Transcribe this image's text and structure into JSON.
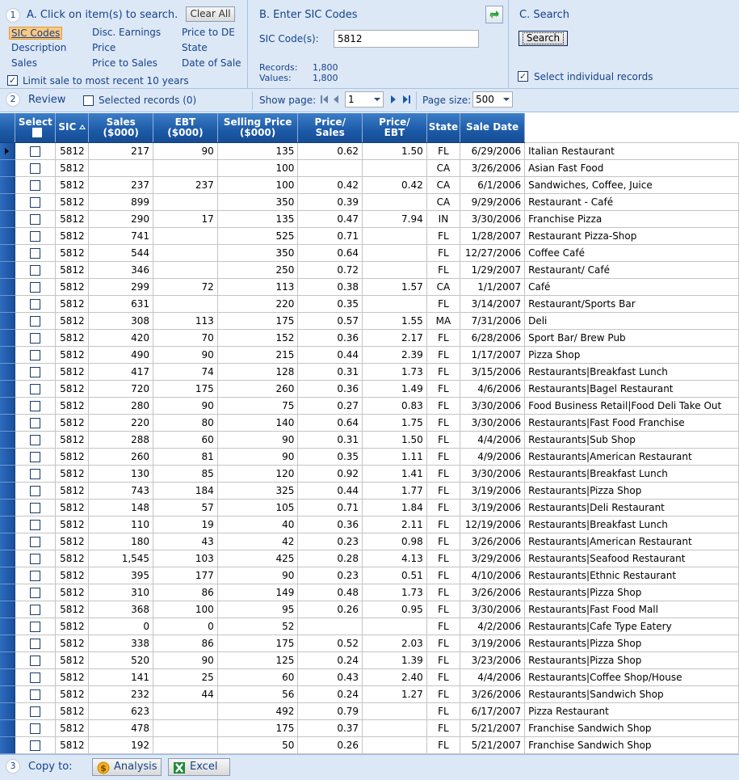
{
  "section_a": {
    "number": "1",
    "title": "A. Click on item(s) to search.",
    "clear_all": "Clear All",
    "items": [
      {
        "label": "SIC Codes",
        "selected": true
      },
      {
        "label": "Disc. Earnings"
      },
      {
        "label": "Price to DE"
      },
      {
        "label": "Description"
      },
      {
        "label": "Price"
      },
      {
        "label": "State"
      },
      {
        "label": "Sales"
      },
      {
        "label": "Price to Sales"
      },
      {
        "label": "Date of Sale"
      }
    ],
    "limit_label": "Limit sale to most recent 10 years",
    "limit_checked": true
  },
  "section_b": {
    "title": "B. Enter SIC Codes",
    "sic_label": "SIC Code(s):",
    "sic_value": "5812",
    "records_label": "Records:",
    "records_value": "1,800",
    "values_label": "Values:",
    "values_value": "1,800"
  },
  "section_c": {
    "title": "C. Search",
    "search_button": "Search",
    "select_individual_label": "Select individual records",
    "select_individual_checked": true
  },
  "toolbar": {
    "number": "2",
    "review_label": "Review",
    "selected_records_label": "Selected records (0)",
    "show_page_label": "Show page:",
    "page_value": "1",
    "page_size_label": "Page size:",
    "page_size_value": "500"
  },
  "grid": {
    "columns": [
      "Select",
      "SIC",
      "Sales ($000)",
      "EBT ($000)",
      "Selling Price ($000)",
      "Price/ Sales",
      "Price/ EBT",
      "State",
      "Sale Date",
      ""
    ],
    "header_lines": {
      "sales": [
        "Sales",
        "($000)"
      ],
      "ebt": [
        "EBT",
        "($000)"
      ],
      "price": [
        "Selling Price",
        "($000)"
      ],
      "ps": [
        "Price/",
        "Sales"
      ],
      "pe": [
        "Price/",
        "EBT"
      ]
    },
    "rows": [
      [
        "5812",
        "217",
        "90",
        "135",
        "0.62",
        "1.50",
        "FL",
        "6/29/2006",
        "Italian Restaurant"
      ],
      [
        "5812",
        "",
        "",
        "100",
        "",
        "",
        "CA",
        "3/26/2006",
        "Asian Fast Food"
      ],
      [
        "5812",
        "237",
        "237",
        "100",
        "0.42",
        "0.42",
        "CA",
        "6/1/2006",
        "Sandwiches, Coffee, Juice"
      ],
      [
        "5812",
        "899",
        "",
        "350",
        "0.39",
        "",
        "CA",
        "9/29/2006",
        "Restaurant - Café"
      ],
      [
        "5812",
        "290",
        "17",
        "135",
        "0.47",
        "7.94",
        "IN",
        "3/30/2006",
        "Franchise Pizza"
      ],
      [
        "5812",
        "741",
        "",
        "525",
        "0.71",
        "",
        "FL",
        "1/28/2007",
        "Restaurant Pizza-Shop"
      ],
      [
        "5812",
        "544",
        "",
        "350",
        "0.64",
        "",
        "FL",
        "12/27/2006",
        "Coffee Café"
      ],
      [
        "5812",
        "346",
        "",
        "250",
        "0.72",
        "",
        "FL",
        "1/29/2007",
        "Restaurant/ Café"
      ],
      [
        "5812",
        "299",
        "72",
        "113",
        "0.38",
        "1.57",
        "CA",
        "1/1/2007",
        "Café"
      ],
      [
        "5812",
        "631",
        "",
        "220",
        "0.35",
        "",
        "FL",
        "3/14/2007",
        "Restaurant/Sports Bar"
      ],
      [
        "5812",
        "308",
        "113",
        "175",
        "0.57",
        "1.55",
        "MA",
        "7/31/2006",
        "Deli"
      ],
      [
        "5812",
        "420",
        "70",
        "152",
        "0.36",
        "2.17",
        "FL",
        "6/28/2006",
        "Sport Bar/ Brew Pub"
      ],
      [
        "5812",
        "490",
        "90",
        "215",
        "0.44",
        "2.39",
        "FL",
        "1/17/2007",
        "Pizza Shop"
      ],
      [
        "5812",
        "417",
        "74",
        "128",
        "0.31",
        "1.73",
        "FL",
        "3/15/2006",
        "Restaurants|Breakfast Lunch"
      ],
      [
        "5812",
        "720",
        "175",
        "260",
        "0.36",
        "1.49",
        "FL",
        "4/6/2006",
        "Restaurants|Bagel Restaurant"
      ],
      [
        "5812",
        "280",
        "90",
        "75",
        "0.27",
        "0.83",
        "FL",
        "3/30/2006",
        "Food Business Retail|Food Deli Take Out"
      ],
      [
        "5812",
        "220",
        "80",
        "140",
        "0.64",
        "1.75",
        "FL",
        "3/30/2006",
        "Restaurants|Fast Food Franchise"
      ],
      [
        "5812",
        "288",
        "60",
        "90",
        "0.31",
        "1.50",
        "FL",
        "4/4/2006",
        "Restaurants|Sub Shop"
      ],
      [
        "5812",
        "260",
        "81",
        "90",
        "0.35",
        "1.11",
        "FL",
        "4/9/2006",
        "Restaurants|American Restaurant"
      ],
      [
        "5812",
        "130",
        "85",
        "120",
        "0.92",
        "1.41",
        "FL",
        "3/30/2006",
        "Restaurants|Breakfast Lunch"
      ],
      [
        "5812",
        "743",
        "184",
        "325",
        "0.44",
        "1.77",
        "FL",
        "3/19/2006",
        "Restaurants|Pizza Shop"
      ],
      [
        "5812",
        "148",
        "57",
        "105",
        "0.71",
        "1.84",
        "FL",
        "3/19/2006",
        "Restaurants|Deli Restaurant"
      ],
      [
        "5812",
        "110",
        "19",
        "40",
        "0.36",
        "2.11",
        "FL",
        "12/19/2006",
        "Restaurants|Breakfast Lunch"
      ],
      [
        "5812",
        "180",
        "43",
        "42",
        "0.23",
        "0.98",
        "FL",
        "3/26/2006",
        "Restaurants|American Restaurant"
      ],
      [
        "5812",
        "1,545",
        "103",
        "425",
        "0.28",
        "4.13",
        "FL",
        "3/29/2006",
        "Restaurants|Seafood Restaurant"
      ],
      [
        "5812",
        "395",
        "177",
        "90",
        "0.23",
        "0.51",
        "FL",
        "4/10/2006",
        "Restaurants|Ethnic Restaurant"
      ],
      [
        "5812",
        "310",
        "86",
        "149",
        "0.48",
        "1.73",
        "FL",
        "3/26/2006",
        "Restaurants|Pizza Shop"
      ],
      [
        "5812",
        "368",
        "100",
        "95",
        "0.26",
        "0.95",
        "FL",
        "3/30/2006",
        "Restaurants|Fast Food Mall"
      ],
      [
        "5812",
        "0",
        "0",
        "52",
        "",
        "",
        "FL",
        "4/2/2006",
        "Restaurants|Cafe Type Eatery"
      ],
      [
        "5812",
        "338",
        "86",
        "175",
        "0.52",
        "2.03",
        "FL",
        "3/19/2006",
        "Restaurants|Pizza Shop"
      ],
      [
        "5812",
        "520",
        "90",
        "125",
        "0.24",
        "1.39",
        "FL",
        "3/23/2006",
        "Restaurants|Pizza Shop"
      ],
      [
        "5812",
        "141",
        "25",
        "60",
        "0.43",
        "2.40",
        "FL",
        "4/4/2006",
        "Restaurants|Coffee Shop/House"
      ],
      [
        "5812",
        "232",
        "44",
        "56",
        "0.24",
        "1.27",
        "FL",
        "3/26/2006",
        "Restaurants|Sandwich Shop"
      ],
      [
        "5812",
        "623",
        "",
        "492",
        "0.79",
        "",
        "FL",
        "6/17/2007",
        "Pizza Restaurant"
      ],
      [
        "5812",
        "478",
        "",
        "175",
        "0.37",
        "",
        "FL",
        "5/21/2007",
        "Franchise Sandwich Shop"
      ],
      [
        "5812",
        "192",
        "",
        "50",
        "0.26",
        "",
        "FL",
        "5/21/2007",
        "Franchise Sandwich Shop"
      ]
    ]
  },
  "bottom": {
    "number": "3",
    "copy_to_label": "Copy to:",
    "analysis_button": "Analysis",
    "excel_button": "Excel"
  },
  "icons": {
    "refresh": "refresh-icon",
    "first_page": "first-page-icon",
    "prev_page": "prev-page-icon",
    "next_page": "next-page-icon",
    "last_page": "last-page-icon",
    "analysis": "analysis-icon",
    "excel": "excel-icon"
  },
  "colors": {
    "panel_bg": "#dde8f6",
    "header_blue": "#1c5aa8",
    "selected_item": "#fbc97e",
    "label_blue": "#15428b"
  }
}
